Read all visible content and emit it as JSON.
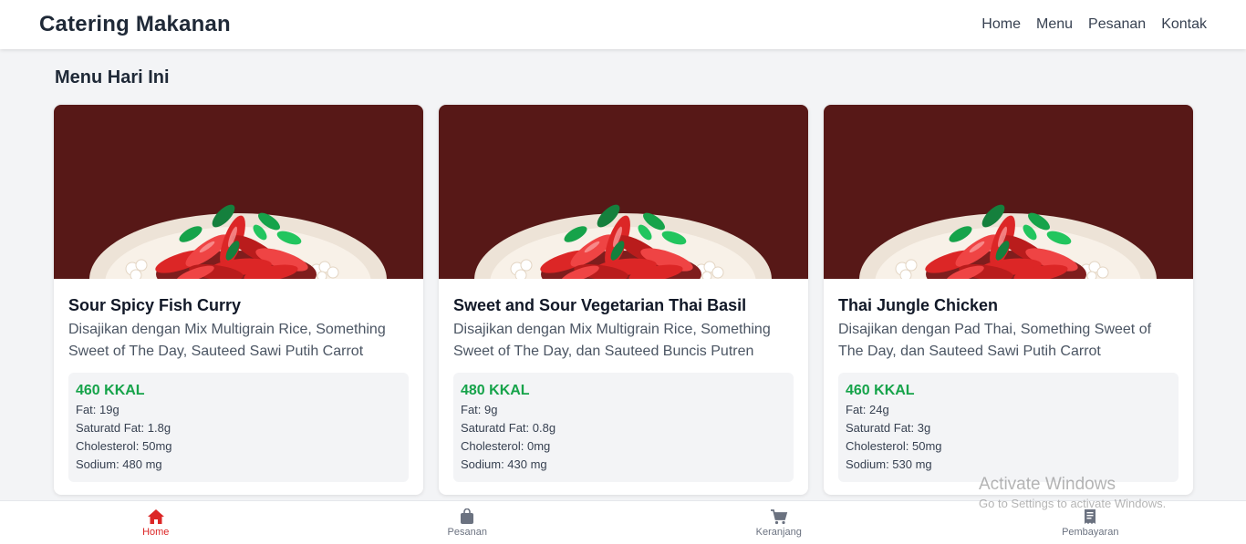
{
  "navbar": {
    "brand": "Catering Makanan",
    "links": [
      "Home",
      "Menu",
      "Pesanan",
      "Kontak"
    ]
  },
  "section_title": "Menu Hari Ini",
  "cards": [
    {
      "title": "Sour Spicy Fish Curry",
      "description": "Disajikan dengan Mix Multigrain Rice, Something Sweet of The Day, Sauteed Sawi Putih Carrot",
      "kcal": "460 KKAL",
      "fat": "Fat: 19g",
      "saturated_fat": "Saturatd Fat: 1.8g",
      "cholesterol": "Cholesterol: 50mg",
      "sodium": "Sodium: 480 mg"
    },
    {
      "title": "Sweet and Sour Vegetarian Thai Basil",
      "description": "Disajikan dengan Mix Multigrain Rice, Something Sweet of The Day, dan Sauteed Buncis Putren",
      "kcal": "480 KKAL",
      "fat": "Fat: 9g",
      "saturated_fat": "Saturatd Fat: 0.8g",
      "cholesterol": "Cholesterol: 0mg",
      "sodium": "Sodium: 430 mg"
    },
    {
      "title": "Thai Jungle Chicken",
      "description": "Disajikan dengan Pad Thai, Something Sweet of The Day, dan Sauteed Sawi Putih Carrot",
      "kcal": "460 KKAL",
      "fat": "Fat: 24g",
      "saturated_fat": "Saturatd Fat: 3g",
      "cholesterol": "Cholesterol: 50mg",
      "sodium": "Sodium: 530 mg"
    }
  ],
  "bottom_nav": [
    {
      "label": "Home",
      "icon": "home-icon",
      "active": true
    },
    {
      "label": "Pesanan",
      "icon": "shopping-bag-icon",
      "active": false
    },
    {
      "label": "Keranjang",
      "icon": "cart-icon",
      "active": false
    },
    {
      "label": "Pembayaran",
      "icon": "receipt-icon",
      "active": false
    }
  ],
  "watermark": {
    "title": "Activate Windows",
    "subtitle": "Go to Settings to activate Windows."
  },
  "colors": {
    "accent_active": "#dc2626",
    "kcal_green": "#16a34a",
    "image_background": "#5a1a19"
  }
}
